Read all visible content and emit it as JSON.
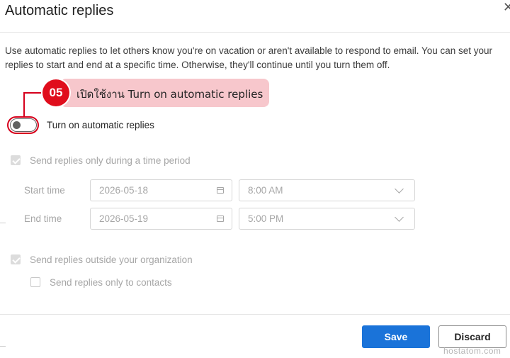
{
  "dialog": {
    "title": "Automatic replies",
    "close_icon": "close-icon",
    "description": "Use automatic replies to let others know you're on vacation or aren't available to respond to email. You can set your replies to start and end at a specific time. Otherwise, they'll continue until you turn them off."
  },
  "callout": {
    "step": "05",
    "text": "เปิดใช้งาน Turn on automatic replies",
    "color": "#e00d1c",
    "background": "#f7c7cc"
  },
  "toggle": {
    "label": "Turn on automatic replies",
    "on": false
  },
  "time_period": {
    "label": "Send replies only during a time period",
    "checked": true,
    "disabled": true,
    "start": {
      "label": "Start time",
      "date": "2026-05-18",
      "time": "8:00 AM"
    },
    "end": {
      "label": "End time",
      "date": "2026-05-19",
      "time": "5:00 PM"
    }
  },
  "outside": {
    "label": "Send replies outside your organization",
    "checked": true,
    "disabled": true,
    "contacts_only": {
      "label": "Send replies only to contacts",
      "checked": false
    }
  },
  "footer": {
    "save_label": "Save",
    "discard_label": "Discard",
    "accent": "#1a73d9"
  },
  "watermark": "hostatom.com"
}
